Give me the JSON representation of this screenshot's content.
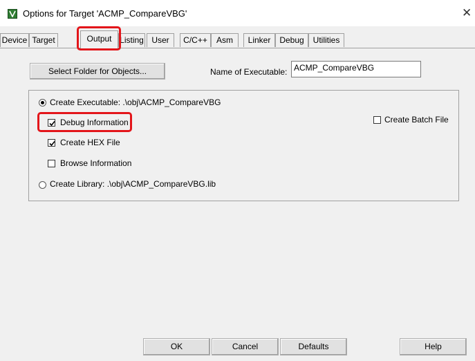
{
  "window": {
    "title": "Options for Target 'ACMP_CompareVBG'",
    "close_glyph": "✕"
  },
  "tabs": [
    {
      "label": "Device"
    },
    {
      "label": "Target"
    },
    {
      "label": "Output",
      "active": true
    },
    {
      "label": "Listing"
    },
    {
      "label": "User"
    },
    {
      "label": "C/C++"
    },
    {
      "label": "Asm"
    },
    {
      "label": "Linker"
    },
    {
      "label": "Debug"
    },
    {
      "label": "Utilities"
    }
  ],
  "output": {
    "select_folder_label": "Select Folder for Objects...",
    "executable_name_label": "Name of Executable:",
    "executable_name_value": "ACMP_CompareVBG",
    "create_executable_label": "Create Executable:  .\\obj\\ACMP_CompareVBG",
    "create_executable_selected": true,
    "debug_info_label": "Debug Information",
    "debug_info_checked": true,
    "create_hex_label": "Create HEX File",
    "create_hex_checked": true,
    "browse_info_label": "Browse Information",
    "browse_info_checked": false,
    "create_library_label": "Create Library:  .\\obj\\ACMP_CompareVBG.lib",
    "create_library_selected": false,
    "create_batch_label": "Create Batch File",
    "create_batch_checked": false
  },
  "buttons": {
    "ok": "OK",
    "cancel": "Cancel",
    "defaults": "Defaults",
    "help": "Help"
  },
  "colors": {
    "highlight": "#e3151a",
    "dialog_bg": "#f0f0f0"
  }
}
